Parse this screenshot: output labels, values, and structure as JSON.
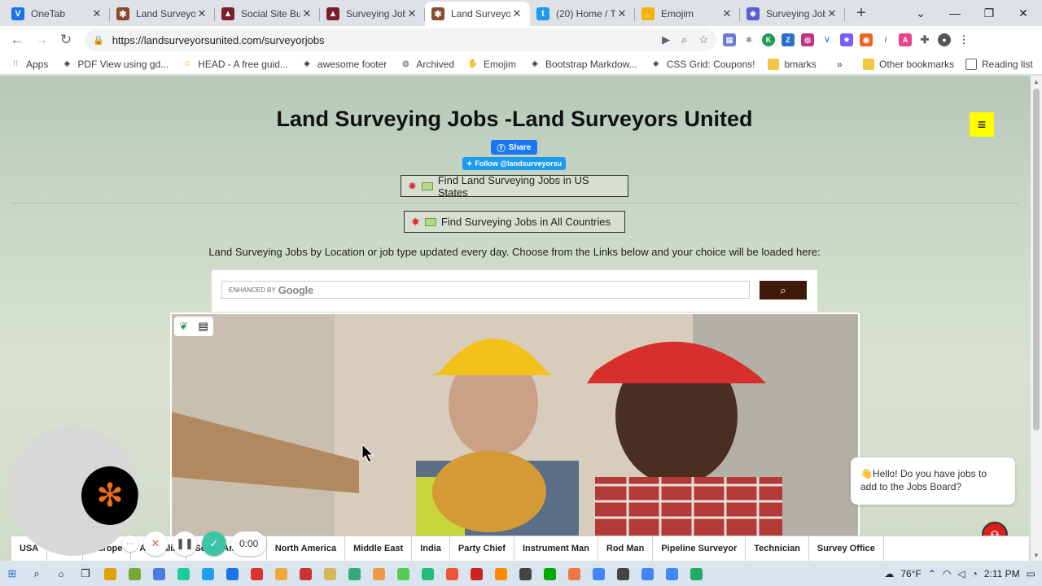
{
  "tabs": [
    {
      "title": "OneTab",
      "color": "#1a73e8",
      "glyph": "V",
      "active": false
    },
    {
      "title": "Land Surveyors",
      "color": "#8b4a2b",
      "glyph": "✱",
      "active": false
    },
    {
      "title": "Social Site Bu",
      "color": "#7b1e2b",
      "glyph": "▲",
      "active": false
    },
    {
      "title": "Surveying Job",
      "color": "#7b1e2b",
      "glyph": "▲",
      "active": false
    },
    {
      "title": "Land Surveyors",
      "color": "#8b4a2b",
      "glyph": "✱",
      "active": true
    },
    {
      "title": "(20) Home / T",
      "color": "#1d9bf0",
      "glyph": "t",
      "active": false
    },
    {
      "title": "Emojim",
      "color": "#f4b400",
      "glyph": "✋",
      "active": false
    },
    {
      "title": "Surveying Job",
      "color": "#5b5bd6",
      "glyph": "✷",
      "active": false
    }
  ],
  "address": {
    "url": "https://landsurveyorsunited.com/surveyorjobs"
  },
  "bookmarks": [
    {
      "label": "Apps",
      "icon": "apps-icon"
    },
    {
      "label": "PDF View using gd...",
      "icon": "codepen-icon"
    },
    {
      "label": "HEAD - A free guid...",
      "icon": "emoji-icon"
    },
    {
      "label": "awesome footer",
      "icon": "codepen-icon"
    },
    {
      "label": "Archived",
      "icon": "globe-icon"
    },
    {
      "label": "Emojim",
      "icon": "hand-icon"
    },
    {
      "label": "Bootstrap Markdow...",
      "icon": "codepen-icon"
    },
    {
      "label": "CSS Grid: Coupons!",
      "icon": "codepen-icon"
    },
    {
      "label": "bmarks",
      "icon": "folder-icon"
    }
  ],
  "bookmarks_right": {
    "other": "Other bookmarks",
    "reading": "Reading list"
  },
  "page": {
    "title": "Land Surveying Jobs -Land Surveyors United",
    "fb_share": "Share",
    "tw_follow": "Follow @landsurveyorsu",
    "btn_us": "Find Land Surveying Jobs in US States",
    "btn_all": "Find Surveying Jobs in All Countries",
    "intro": "Land Surveying Jobs by Location or job type updated every day. Choose from the Links below and your choice will be loaded here:",
    "search_prefix": "ENHANCED BY",
    "search_brand": "Google",
    "chat_message": "👋Hello! Do you have jobs to add to the Jobs Board?",
    "rec_time": "0:00"
  },
  "location_links": [
    "USA",
    "Asia",
    "Europe",
    "Australia",
    "South America",
    "North America",
    "Middle East",
    "India",
    "Party Chief",
    "Instrument Man",
    "Rod Man",
    "Pipeline Surveyor",
    "Technician",
    "Survey Office"
  ],
  "taskbar": {
    "weather": "76°F",
    "time": "2:11 PM"
  }
}
